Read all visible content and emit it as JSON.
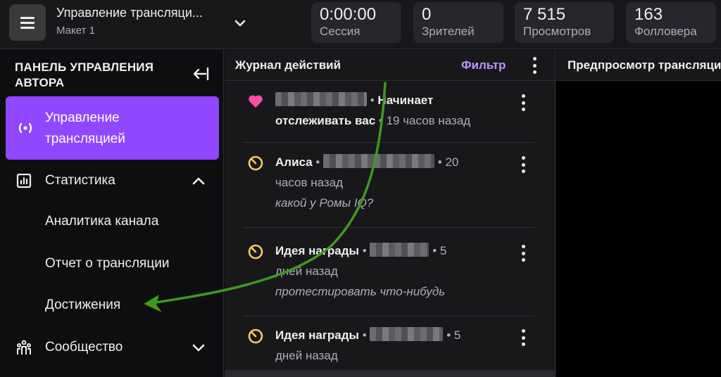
{
  "header": {
    "menu_icon": "hamburger-icon",
    "title": "Управление трансляци...",
    "subtitle": "Макет 1",
    "stats": {
      "session": {
        "value": "0:00:00",
        "label": "Сессия"
      },
      "viewers": {
        "value": "0",
        "label": "Зрителей"
      },
      "views": {
        "value": "7 515",
        "label": "Просмотров"
      },
      "followers": {
        "value": "163",
        "label": "Фолловера"
      }
    }
  },
  "sidebar": {
    "heading": "ПАНЕЛЬ УПРАВЛЕНИЯ АВТОРА",
    "items": [
      {
        "label": "Управление трансляцией",
        "icon": "broadcast-icon",
        "active": true
      },
      {
        "label": "Статистика",
        "icon": "stats-icon",
        "expanded": true
      },
      {
        "label": "Аналитика канала"
      },
      {
        "label": "Отчет о трансляции"
      },
      {
        "label": "Достижения"
      },
      {
        "label": "Сообщество",
        "icon": "community-icon",
        "expanded": false
      }
    ]
  },
  "feed": {
    "title": "Журнал действий",
    "filter_label": "Фильтр",
    "items": [
      {
        "icon": "heart-icon",
        "action_a": "Начинает",
        "action_b": "отслеживать вас",
        "time": "19 часов назад",
        "message": ""
      },
      {
        "icon": "reward-icon",
        "name": "Алиса",
        "time_a": "20",
        "time_b": "часов назад",
        "message": "какой у Ромы IQ?"
      },
      {
        "icon": "reward-icon",
        "name": "Идея награды",
        "time_a": "5",
        "time_b": "дней назад",
        "message": "протестировать что-нибудь"
      },
      {
        "icon": "reward-icon",
        "name": "Идея награды",
        "time_a": "5",
        "time_b": "дней назад",
        "message": ""
      }
    ]
  },
  "preview": {
    "title": "Предпросмотр трансляции"
  },
  "colors": {
    "accent": "#9147ff",
    "filter": "#bf94ff",
    "heart": "#ff4fa3",
    "reward": "#ffca5f",
    "arrow": "#3d9a1d"
  }
}
